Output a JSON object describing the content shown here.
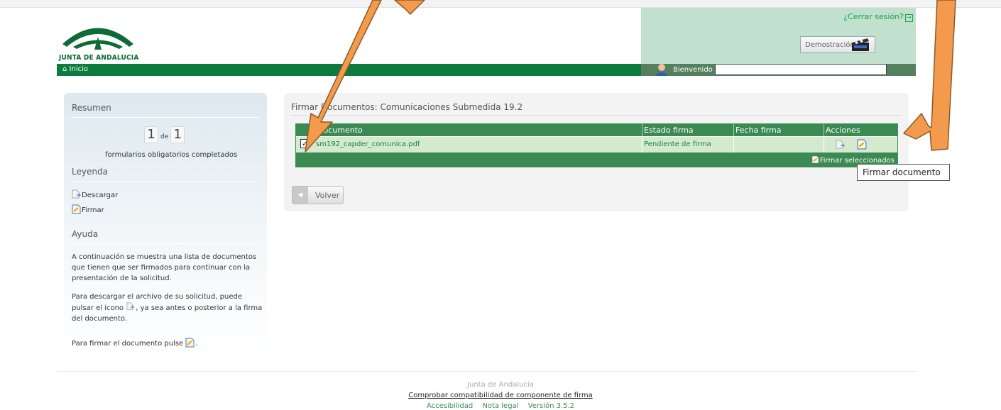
{
  "header": {
    "logo_text": "JUNTA DE ANDALUCIA",
    "logout": "¿Cerrar sesión?",
    "demo_button": "Demostración"
  },
  "nav": {
    "home": "Inicio",
    "welcome": "Bienvenido",
    "user_name": ""
  },
  "sidebar": {
    "resumen_title": "Resumen",
    "counter": {
      "done": "1",
      "of": "de",
      "total": "1"
    },
    "counter_text": "formularios obligatorios completados",
    "leyenda_title": "Leyenda",
    "legend_download": "Descargar",
    "legend_sign": "Firmar",
    "ayuda_title": "Ayuda",
    "help_1": "A continuación se muestra una lista de documentos que tienen que ser firmados para continuar con la presentación de la solicitud.",
    "help_2_a": "Para descargar el archivo de su solicitud, puede pulsar el icono",
    "help_2_b": ", ya sea antes o posterior a la firma del documento.",
    "help_3_a": "Para firmar el documento pulse",
    "help_3_b": "."
  },
  "main": {
    "title": "Firmar Documentos: Comunicaciones Submedida 19.2",
    "columns": [
      "Documento",
      "Estado firma",
      "Fecha firma",
      "Acciones"
    ],
    "rows": [
      {
        "document": "sm192_capder_comunica.pdf",
        "status": "Pendiente de firma",
        "date": "",
        "checked": true
      }
    ],
    "sign_selected": "Firmar seleccionados",
    "back_button": "Volver"
  },
  "tooltip": "Firmar documento",
  "footer": {
    "org": "Junta de Andalucía",
    "compat_link": "Comprobar compatibilidad de componente de firma",
    "accessibility": "Accesibilidad",
    "legal": "Nota legal",
    "version": "Versión 3.5.2"
  },
  "colors": {
    "brand_green": "#0d7b3d",
    "table_green": "#3a8a52",
    "annotation_orange": "#f39a4c"
  }
}
